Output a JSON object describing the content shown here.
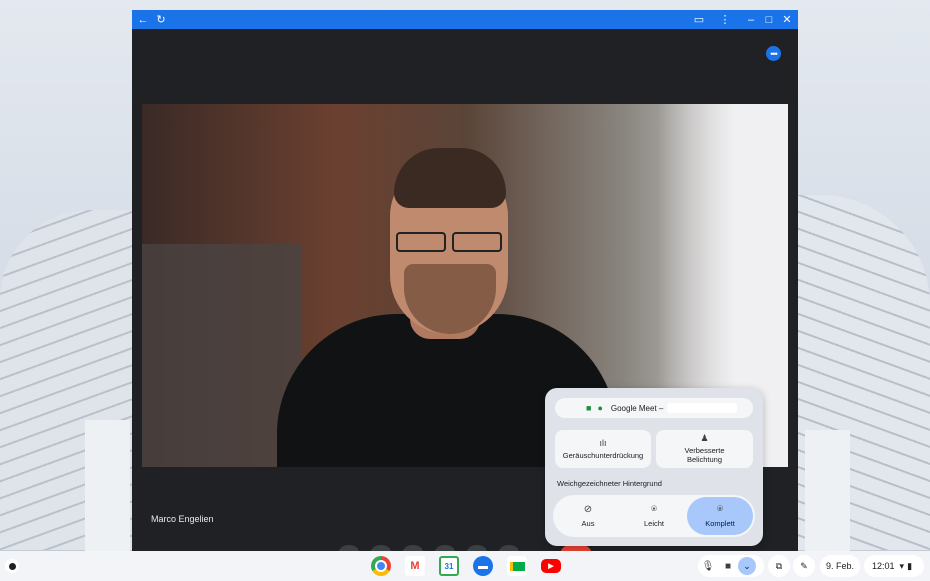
{
  "participant": {
    "name": "Marco Engelien"
  },
  "popup": {
    "app_name": "Google Meet –",
    "noise_suppression_label": "Geräuschunterdrückung",
    "improved_lighting_label": "Verbesserte Belichtung",
    "background_blur_heading": "Weichgezeichneter Hintergrund",
    "blur_options": [
      "Aus",
      "Leicht",
      "Komplett"
    ],
    "selected_blur": "Komplett"
  },
  "shelf": {
    "date": "9. Feb.",
    "time": "12:01",
    "apps": [
      "chrome-icon",
      "gmail-icon",
      "calendar-icon",
      "messages-icon",
      "meet-icon",
      "youtube-icon"
    ]
  },
  "colors": {
    "titlebar": "#1a73e8",
    "window_bg": "#202124",
    "selected_option": "#a8c7fa",
    "meet_green": "#1e8e3e"
  }
}
